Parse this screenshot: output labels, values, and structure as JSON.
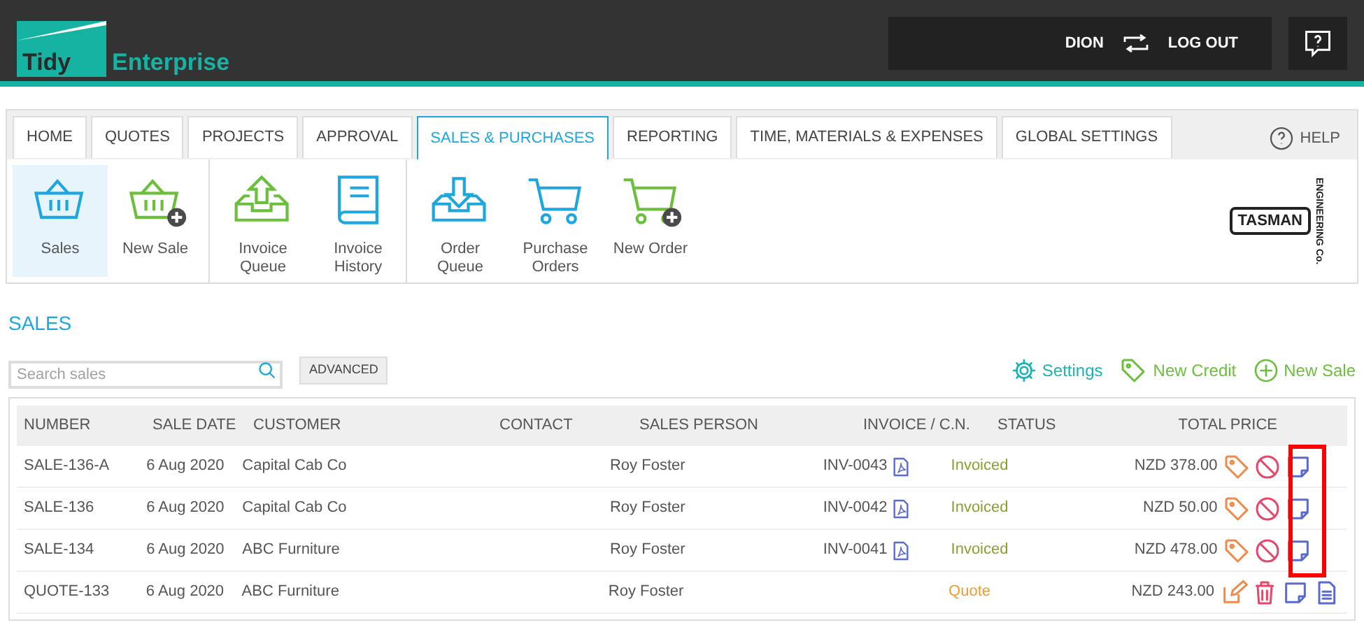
{
  "header": {
    "logo": {
      "word_1": "Tidy",
      "word_2": "Enterprise"
    },
    "user": "DION",
    "logout": "LOG OUT"
  },
  "tabs": [
    {
      "label": "HOME",
      "selected": false
    },
    {
      "label": "QUOTES",
      "selected": false
    },
    {
      "label": "PROJECTS",
      "selected": false
    },
    {
      "label": "APPROVAL",
      "selected": false
    },
    {
      "label": "SALES & PURCHASES",
      "selected": true
    },
    {
      "label": "REPORTING",
      "selected": false
    },
    {
      "label": "TIME, MATERIALS & EXPENSES",
      "selected": false
    },
    {
      "label": "GLOBAL SETTINGS",
      "selected": false
    }
  ],
  "help": "HELP",
  "toolbar_groups": [
    [
      {
        "label": "Sales",
        "kind": "basket",
        "selected": true
      },
      {
        "label": "New Sale",
        "kind": "basket-add",
        "selected": false
      }
    ],
    [
      {
        "label": "Invoice Queue",
        "kind": "upload",
        "selected": false
      },
      {
        "label": "Invoice History",
        "kind": "book",
        "selected": false
      }
    ],
    [
      {
        "label": "Order Queue",
        "kind": "download",
        "selected": false
      },
      {
        "label": "Purchase Orders",
        "kind": "cart",
        "selected": false
      },
      {
        "label": "New Order",
        "kind": "cart-add",
        "selected": false
      }
    ]
  ],
  "company_logo": {
    "name": "TASMAN",
    "subtitle": "ENGINEERING Co."
  },
  "page_title": "SALES",
  "search": {
    "placeholder": "Search sales"
  },
  "advanced": "ADVANCED",
  "actions": [
    {
      "label": "Settings",
      "kind": "settings"
    },
    {
      "label": "New Credit",
      "kind": "credit"
    },
    {
      "label": "New Sale",
      "kind": "add"
    }
  ],
  "table": {
    "columns": [
      "NUMBER",
      "SALE DATE",
      "CUSTOMER",
      "CONTACT",
      "SALES PERSON",
      "INVOICE / C.N.",
      "STATUS",
      "TOTAL PRICE"
    ],
    "rows": [
      {
        "number": "SALE-136-A",
        "date": "6 Aug 2020",
        "customer": "Capital Cab Co",
        "person": "Roy Foster",
        "invoice": "INV-0043",
        "status": "Invoiced",
        "kind": "invoiced",
        "total": "NZD 378.00"
      },
      {
        "number": "SALE-136",
        "date": "6 Aug 2020",
        "customer": "Capital Cab Co",
        "person": "Roy Foster",
        "invoice": "INV-0042",
        "status": "Invoiced",
        "kind": "invoiced",
        "total": "NZD 50.00"
      },
      {
        "number": "SALE-134",
        "date": "6 Aug 2020",
        "customer": "ABC Furniture",
        "person": "Roy Foster",
        "invoice": "INV-0041",
        "status": "Invoiced",
        "kind": "invoiced",
        "total": "NZD 478.00"
      },
      {
        "number": "QUOTE-133",
        "date": "6 Aug 2020",
        "customer": "ABC Furniture",
        "person": "Roy Foster",
        "status": "Quote",
        "kind": "quote",
        "total": "NZD 243.00"
      }
    ]
  },
  "highlight": {
    "on": true
  }
}
